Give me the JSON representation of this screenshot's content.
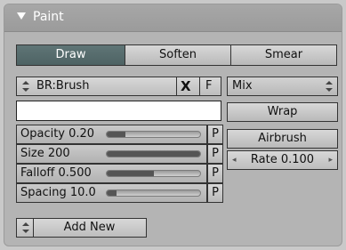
{
  "panel": {
    "title": "Paint"
  },
  "tabs": [
    {
      "label": "Draw",
      "active": true
    },
    {
      "label": "Soften",
      "active": false
    },
    {
      "label": "Smear",
      "active": false
    }
  ],
  "brush": {
    "name": "BR:Brush",
    "clear_label": "X",
    "fake_user_label": "F"
  },
  "blend_mode": {
    "selected": "Mix"
  },
  "wrap_label": "Wrap",
  "airbrush_label": "Airbrush",
  "rate": {
    "label": "Rate 0.100"
  },
  "color_swatch": "#ffffff",
  "sliders": [
    {
      "label": "Opacity 0.20",
      "fraction": 0.2,
      "p_label": "P"
    },
    {
      "label": "Size 200",
      "fraction": 1.0,
      "p_label": "P"
    },
    {
      "label": "Falloff 0.500",
      "fraction": 0.5,
      "p_label": "P"
    },
    {
      "label": "Spacing 10.0",
      "fraction": 0.1,
      "p_label": "P"
    }
  ],
  "add_new_label": "Add New",
  "colors": {
    "active_tab": "#5b7071",
    "panel_bg": "#b4b4b4"
  }
}
